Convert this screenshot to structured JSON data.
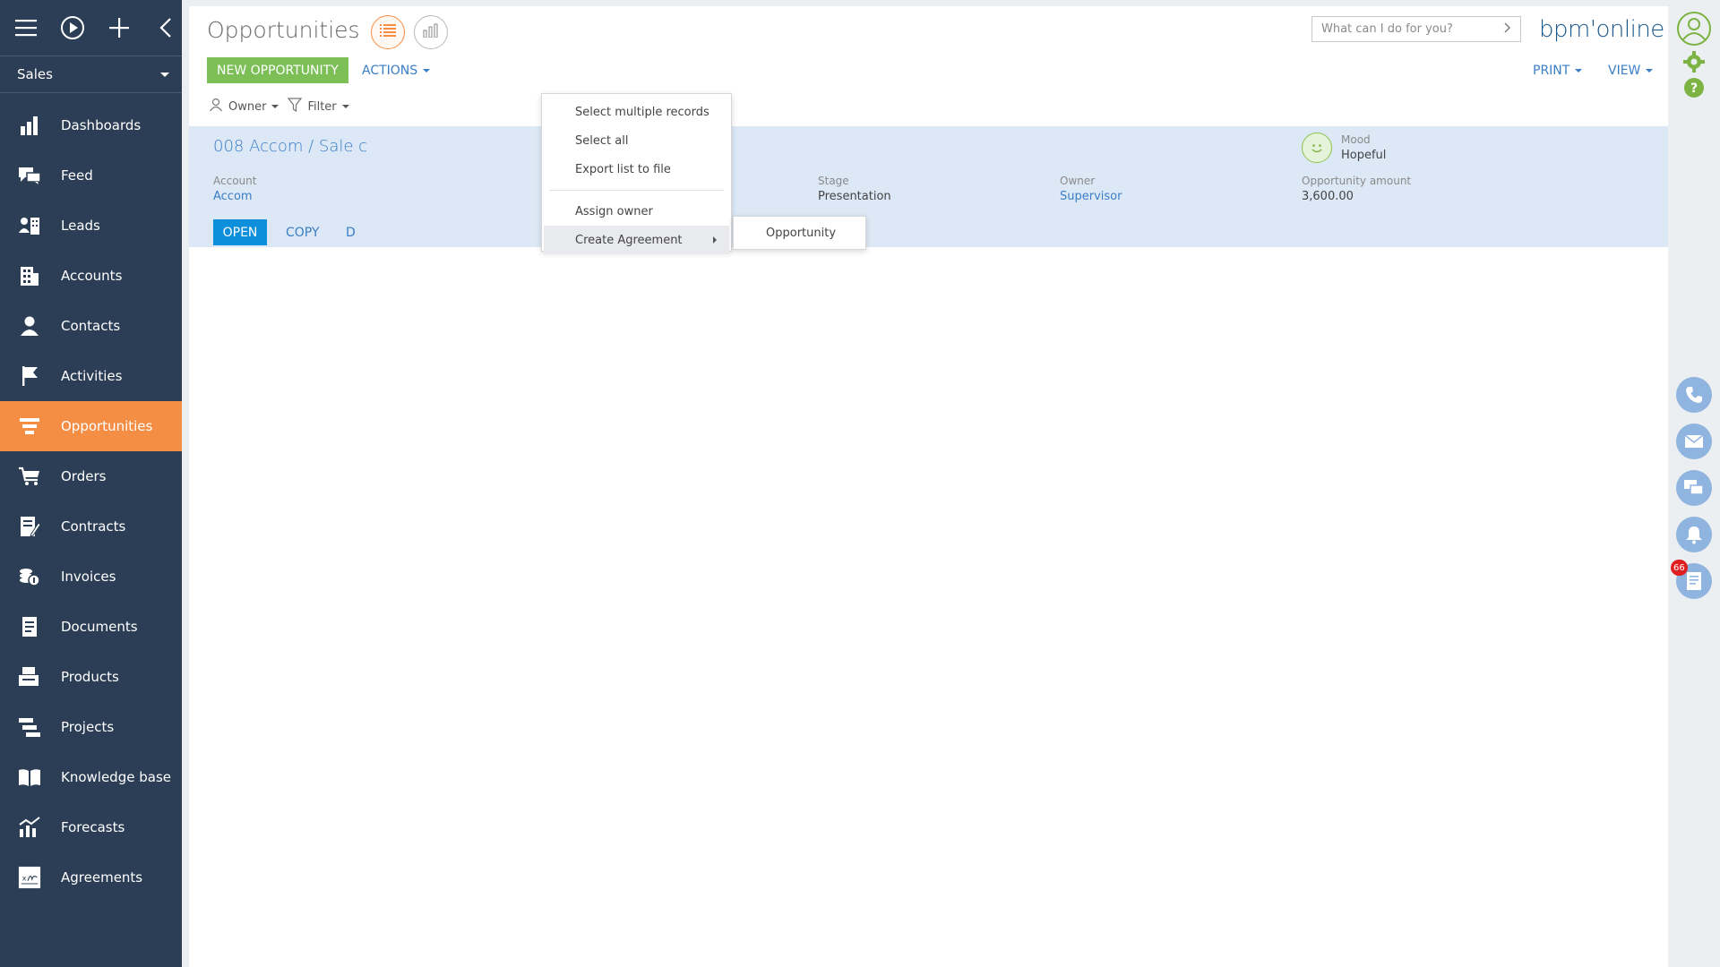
{
  "sidebar": {
    "workspace": "Sales",
    "items": [
      {
        "label": "Dashboards",
        "icon": "dashboards-icon"
      },
      {
        "label": "Feed",
        "icon": "feed-icon"
      },
      {
        "label": "Leads",
        "icon": "leads-icon"
      },
      {
        "label": "Accounts",
        "icon": "accounts-icon"
      },
      {
        "label": "Contacts",
        "icon": "contacts-icon"
      },
      {
        "label": "Activities",
        "icon": "activities-flag-icon"
      },
      {
        "label": "Opportunities",
        "icon": "opportunities-funnel-icon",
        "active": true
      },
      {
        "label": "Orders",
        "icon": "orders-cart-icon"
      },
      {
        "label": "Contracts",
        "icon": "contracts-icon"
      },
      {
        "label": "Invoices",
        "icon": "invoices-icon"
      },
      {
        "label": "Documents",
        "icon": "documents-icon"
      },
      {
        "label": "Products",
        "icon": "products-icon"
      },
      {
        "label": "Projects",
        "icon": "projects-icon"
      },
      {
        "label": "Knowledge base",
        "icon": "knowledge-base-book-icon"
      },
      {
        "label": "Forecasts",
        "icon": "forecasts-chart-icon"
      },
      {
        "label": "Agreements",
        "icon": "agreements-icon"
      }
    ]
  },
  "header": {
    "title": "Opportunities",
    "search_placeholder": "What can I do for you?",
    "logo": "bpm'online"
  },
  "toolbar": {
    "new_label": "NEW OPPORTUNITY",
    "actions_label": "ACTIONS",
    "print_label": "PRINT",
    "view_label": "VIEW"
  },
  "filters": {
    "owner_label": "Owner",
    "filter_label": "Filter"
  },
  "record": {
    "title": "008 Accom / Sale c",
    "account_label": "Account",
    "account_value": "Accom",
    "stage_label": "Stage",
    "stage_value": "Presentation",
    "owner_label": "Owner",
    "owner_value": "Supervisor",
    "mood_label": "Mood",
    "mood_value": "Hopeful",
    "amount_label": "Opportunity amount",
    "amount_value": "3,600.00",
    "open_label": "OPEN",
    "copy_label": "COPY",
    "third_label": "D"
  },
  "actions_menu": {
    "items": [
      "Select multiple records",
      "Select all",
      "Export list to file"
    ],
    "assign_owner": "Assign owner",
    "create_agreement": "Create Agreement",
    "submenu_item": "Opportunity"
  },
  "rail": {
    "notification_count": "66"
  },
  "colors": {
    "sidebar_bg": "#2c3e55",
    "accent_orange": "#f58e45",
    "new_button_green": "#7bbf56",
    "link_blue": "#3a7ec5",
    "open_button_blue": "#0d8fdc",
    "record_bg": "#dce8f5"
  }
}
